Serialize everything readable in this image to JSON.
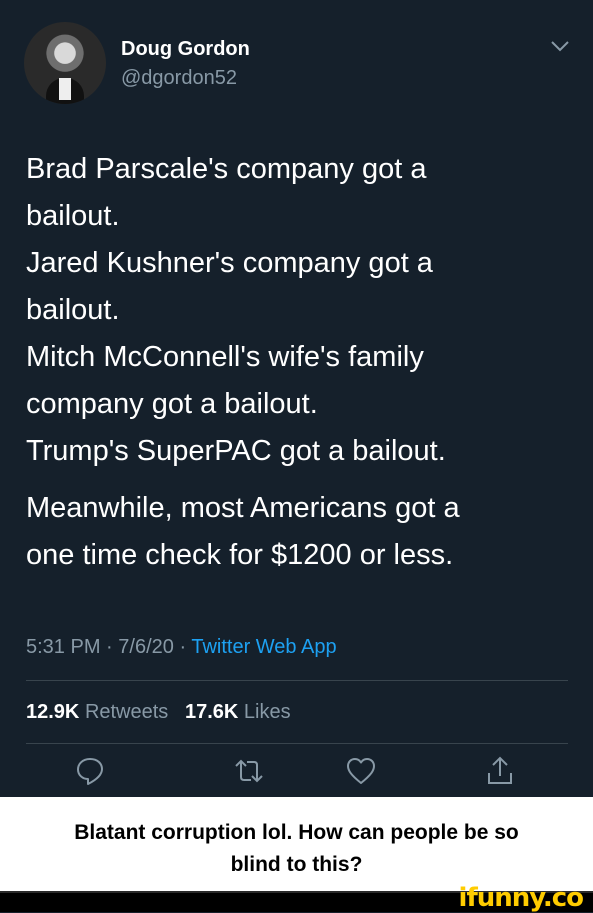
{
  "tweet": {
    "author_name": "Doug Gordon",
    "author_handle": "@dgordon52",
    "lines": [
      "Brad Parscale's company got a",
      "bailout.",
      "Jared Kushner's company got a",
      "bailout.",
      "Mitch McConnell's wife's family",
      "company got a bailout.",
      "Trump's SuperPAC got a bailout."
    ],
    "lines2": [
      "Meanwhile, most Americans got a",
      "one time check for $1200 or less."
    ],
    "time": "5:31 PM",
    "date": "7/6/20",
    "separator": "·",
    "source": "Twitter Web App",
    "retweets_count": "12.9K",
    "retweets_label": "Retweets",
    "likes_count": "17.6K",
    "likes_label": "Likes"
  },
  "caption": {
    "line1": "Blatant corruption lol. How can people be so",
    "line2": "blind to this?"
  },
  "footer": {
    "logo": "ifunny.co"
  },
  "colors": {
    "background": "#15202b",
    "muted": "#8899a6",
    "link": "#1da1f2",
    "divider": "#38444d",
    "logo": "#ffcc00"
  },
  "icons": [
    "chevron-down-icon",
    "reply-icon",
    "retweet-icon",
    "like-icon",
    "share-icon"
  ]
}
